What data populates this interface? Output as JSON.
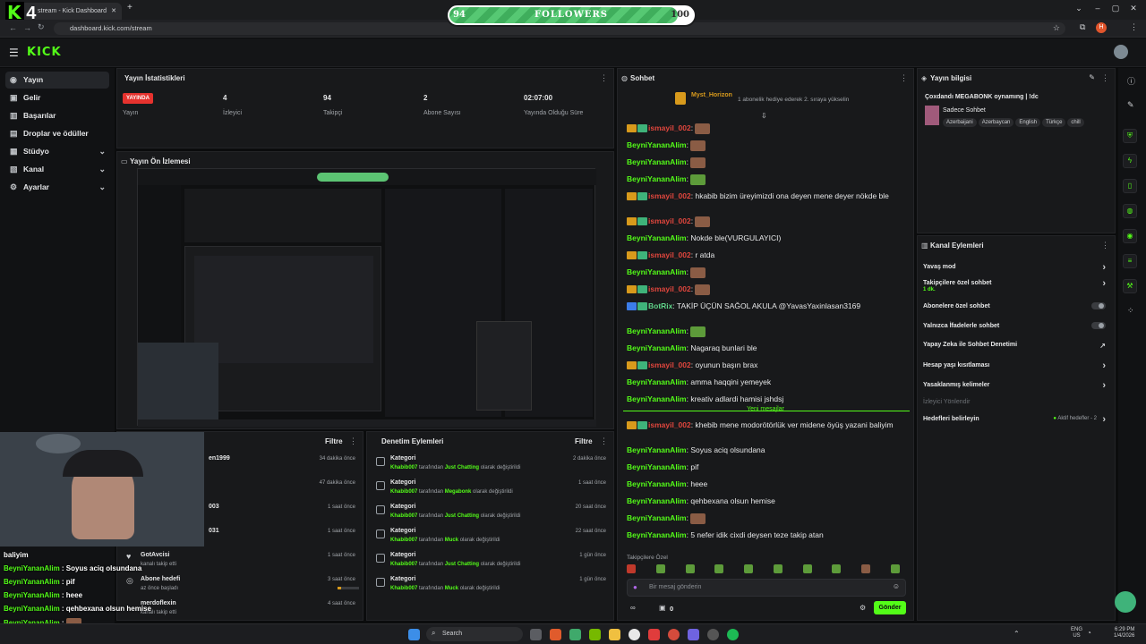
{
  "browser": {
    "tab_title": "stream - Kick Dashboard",
    "url": "dashboard.kick.com/stream",
    "overlay_number": "4"
  },
  "followers_goal": {
    "label": "FOLLOWERS",
    "current": "94",
    "target": "100",
    "progress_fraction": 0.94
  },
  "sidebar": {
    "items": [
      {
        "label": "Yayın",
        "icon": "broadcast-icon"
      },
      {
        "label": "Gelir",
        "icon": "income-icon"
      },
      {
        "label": "Başarılar",
        "icon": "trophy-icon"
      },
      {
        "label": "Droplar ve ödüller",
        "icon": "gift-icon"
      },
      {
        "label": "Stüdyo",
        "icon": "studio-icon"
      },
      {
        "label": "Kanal",
        "icon": "channel-icon"
      },
      {
        "label": "Ayarlar",
        "icon": "gear-icon"
      }
    ]
  },
  "stats": {
    "title": "Yayın İstatistikleri",
    "live_badge": "YAYINDA",
    "items": [
      {
        "value": "",
        "label": "Yayın"
      },
      {
        "value": "4",
        "label": "İzleyici"
      },
      {
        "value": "94",
        "label": "Takipçi"
      },
      {
        "value": "2",
        "label": "Abone Sayısı"
      },
      {
        "value": "02:07:00",
        "label": "Yayında Olduğu Süre"
      }
    ]
  },
  "preview": {
    "title": "Yayın Ön İzlemesi"
  },
  "activity": {
    "filter_label": "Filtre",
    "items": [
      {
        "name": "en1999",
        "sub": "",
        "time": "34 dakika önce"
      },
      {
        "name": "",
        "sub": "",
        "time": "47 dakika önce"
      },
      {
        "name": "003",
        "sub": "",
        "time": "1 saat önce"
      },
      {
        "name": "031",
        "sub": "",
        "time": "1 saat önce"
      },
      {
        "name": "GotAvcisi",
        "sub": "kanalı takip etti",
        "time": "1 saat önce"
      },
      {
        "name": "Abone hedefi",
        "sub": "az önce başladı",
        "time": "3 saat önce"
      },
      {
        "name": "merdoflexin",
        "sub": "kanalı takip etti",
        "time": "4 saat önce"
      }
    ]
  },
  "moderation": {
    "title": "Denetim Eylemleri",
    "filter_label": "Filtre",
    "items": [
      {
        "title": "Kategori",
        "user": "Khabib007",
        "mid": " tarafından ",
        "cat": "Just Chatting",
        "end": " olarak değiştirildi",
        "time": "2 dakika önce"
      },
      {
        "title": "Kategori",
        "user": "Khabib007",
        "mid": " tarafından ",
        "cat": "Megabonk",
        "end": " olarak değiştirildi",
        "time": "1 saat önce"
      },
      {
        "title": "Kategori",
        "user": "Khabib007",
        "mid": " tarafından ",
        "cat": "Just Chatting",
        "end": " olarak değiştirildi",
        "time": "20 saat önce"
      },
      {
        "title": "Kategori",
        "user": "Khabib007",
        "mid": " tarafından ",
        "cat": "Muck",
        "end": " olarak değiştirildi",
        "time": "22 saat önce"
      },
      {
        "title": "Kategori",
        "user": "Khabib007",
        "mid": " tarafından ",
        "cat": "Just Chatting",
        "end": " olarak değiştirildi",
        "time": "1 gün önce"
      },
      {
        "title": "Kategori",
        "user": "Khabib007",
        "mid": " tarafından ",
        "cat": "Muck",
        "end": " olarak değiştirildi",
        "time": "1 gün önce"
      }
    ]
  },
  "chat": {
    "title": "Sohbet",
    "pinned_user": "Myst_Horizon",
    "pinned_text": "1 abonelik hediye ederek 2. sıraya yükselin",
    "new_messages_label": "Yeni mesajlar",
    "followers_only_label": "Takipçilere Özel",
    "input_placeholder": "Bir mesaj gönderin",
    "send_label": "Gönder",
    "footer_count": "0",
    "messages": [
      {
        "user": "ismayil_002",
        "color": "r",
        "text": "",
        "emote": true
      },
      {
        "user": "BeyniYananAlim",
        "color": "g",
        "text": "",
        "emote": true
      },
      {
        "user": "BeyniYananAlim",
        "color": "g",
        "text": "",
        "emote": true
      },
      {
        "user": "BeyniYananAlim",
        "color": "g",
        "text": "",
        "emote": true
      },
      {
        "user": "ismayil_002",
        "color": "r",
        "text": "hkabib bizim üreyimizdi ona deyen mene deyer nökde ble",
        "emote": false
      },
      {
        "user": "ismayil_002",
        "color": "r",
        "text": "",
        "emote": true
      },
      {
        "user": "BeyniYananAlim",
        "color": "g",
        "text": "Nokde ble(VURGULAYICI)",
        "emote": false
      },
      {
        "user": "ismayil_002",
        "color": "r",
        "text": "r atda",
        "emote": false
      },
      {
        "user": "BeyniYananAlim",
        "color": "g",
        "text": "",
        "emote": true
      },
      {
        "user": "ismayil_002",
        "color": "r",
        "text": "",
        "emote": true
      },
      {
        "user": "BotRix",
        "color": "gr",
        "text": "TAKİP ÜÇÜN SAĞOL AKULA @YavasYaxinlasan3169",
        "emote": false
      },
      {
        "user": "BeyniYananAlim",
        "color": "g",
        "text": "",
        "emote": true
      },
      {
        "user": "BeyniYananAlim",
        "color": "g",
        "text": "Nagaraq bunlari ble",
        "emote": false
      },
      {
        "user": "ismayil_002",
        "color": "r",
        "text": "oyunun başın brax",
        "emote": false
      },
      {
        "user": "BeyniYananAlim",
        "color": "g",
        "text": "amma haqqini yemeyek",
        "emote": false
      },
      {
        "user": "BeyniYananAlim",
        "color": "g",
        "text": "kreativ adlardi hamisi jshdsj",
        "emote": false
      }
    ],
    "messages_after": [
      {
        "user": "ismayil_002",
        "color": "r",
        "text": "khebib mene modorötörlük ver midene öyüş yazani baliyim",
        "emote": false
      },
      {
        "user": "BeyniYananAlim",
        "color": "g",
        "text": "Soyus aciq olsundana",
        "emote": false
      },
      {
        "user": "BeyniYananAlim",
        "color": "g",
        "text": "pif",
        "emote": false
      },
      {
        "user": "BeyniYananAlim",
        "color": "g",
        "text": "heee",
        "emote": false
      },
      {
        "user": "BeyniYananAlim",
        "color": "g",
        "text": "qehbexana olsun hemise",
        "emote": false
      },
      {
        "user": "BeyniYananAlim",
        "color": "g",
        "text": "",
        "emote": true
      },
      {
        "user": "BeyniYananAlim",
        "color": "g",
        "text": "5 nefer idik cixdi deysen teze takip atan",
        "emote": false
      }
    ]
  },
  "stream_info": {
    "title": "Yayın bilgisi",
    "stream_title": "Çoxdandı MEGABONK oynamıng | !dc",
    "category": "Sadece Sohbet",
    "tags": [
      "Azerbaijani",
      "Azerbaycan",
      "English",
      "Türkçe",
      "chill"
    ]
  },
  "channel_actions": {
    "title": "Kanal Eylemleri",
    "slow_mode": "Yavaş mod",
    "followers_chat": "Takipçilere özel sohbet",
    "followers_chat_value": "1 dk.",
    "subs_chat": "Abonelere özel sohbet",
    "emotes_chat": "Yalnızca İfadelerle sohbet",
    "ai_moderation": "Yapay Zeka ile Sohbet Denetimi",
    "account_age": "Hesap yaşı kısıtlaması",
    "banned_words": "Yasaklanmış kelimeler",
    "viewer_redirect": "İzleyici Yönlendir",
    "goals": "Hedefleri belirleyin",
    "goals_status": "Aktif hedefler - 2"
  },
  "overlay_chat": [
    {
      "user": "",
      "text": "baliyim"
    },
    {
      "user": "BeyniYananAlim",
      "text": "Soyus aciq olsundana"
    },
    {
      "user": "BeyniYananAlim",
      "text": "pif"
    },
    {
      "user": "BeyniYananAlim",
      "text": "heee"
    },
    {
      "user": "BeyniYananAlim",
      "text": "qehbexana olsun hemise"
    },
    {
      "user": "BeyniYananAlim",
      "text": ""
    },
    {
      "user": "BeyniYananAlim",
      "text": "5 nefer idik cixdi deysen teze takip atan"
    }
  ],
  "taskbar": {
    "search_placeholder": "Search",
    "lang": "ENG",
    "region": "US",
    "time": "6:29 PM",
    "date": "1/4/2026"
  },
  "colors": {
    "accent": "#53fc18",
    "live": "#e6322e",
    "panel": "#18191b"
  }
}
